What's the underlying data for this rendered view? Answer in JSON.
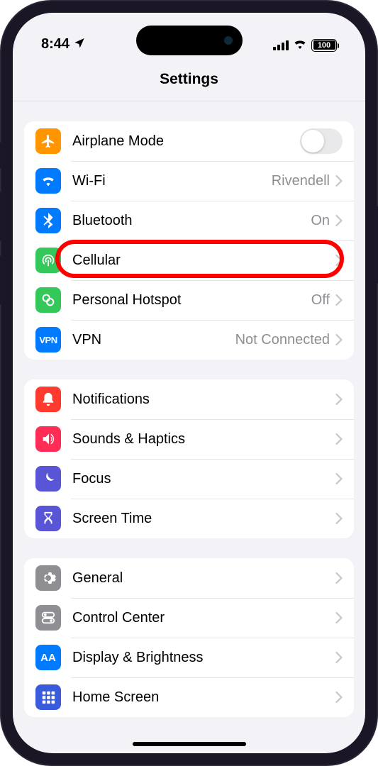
{
  "status": {
    "time": "8:44",
    "battery": "100"
  },
  "page_title": "Settings",
  "colors": {
    "orange": "#ff9500",
    "blue": "#007aff",
    "green": "#34c759",
    "red": "#ff3b30",
    "rose": "#ff2d55",
    "indigo": "#5856d6",
    "gray": "#8e8e93",
    "appblue": "#1f6dff"
  },
  "groups": [
    {
      "items": [
        {
          "name": "airplane",
          "label": "Airplane Mode",
          "icon": "airplane-icon",
          "color": "orange",
          "control": "toggle",
          "toggle_on": false
        },
        {
          "name": "wifi",
          "label": "Wi-Fi",
          "icon": "wifi-icon",
          "color": "blue",
          "value": "Rivendell",
          "chevron": true
        },
        {
          "name": "bluetooth",
          "label": "Bluetooth",
          "icon": "bluetooth-icon",
          "color": "blue",
          "value": "On",
          "chevron": true
        },
        {
          "name": "cellular",
          "label": "Cellular",
          "icon": "cellular-icon",
          "color": "green",
          "chevron": true,
          "highlighted": true
        },
        {
          "name": "hotspot",
          "label": "Personal Hotspot",
          "icon": "hotspot-icon",
          "color": "green",
          "value": "Off",
          "chevron": true
        },
        {
          "name": "vpn",
          "label": "VPN",
          "icon": "vpn-icon",
          "color": "blue",
          "value": "Not Connected",
          "chevron": true
        }
      ]
    },
    {
      "items": [
        {
          "name": "notifications",
          "label": "Notifications",
          "icon": "bell-icon",
          "color": "red",
          "chevron": true
        },
        {
          "name": "sounds",
          "label": "Sounds & Haptics",
          "icon": "speaker-icon",
          "color": "rose",
          "chevron": true
        },
        {
          "name": "focus",
          "label": "Focus",
          "icon": "moon-icon",
          "color": "indigo",
          "chevron": true
        },
        {
          "name": "screentime",
          "label": "Screen Time",
          "icon": "hourglass-icon",
          "color": "indigo",
          "chevron": true
        }
      ]
    },
    {
      "items": [
        {
          "name": "general",
          "label": "General",
          "icon": "gear-icon",
          "color": "gray",
          "chevron": true
        },
        {
          "name": "controlcenter",
          "label": "Control Center",
          "icon": "switches-icon",
          "color": "gray",
          "chevron": true
        },
        {
          "name": "display",
          "label": "Display & Brightness",
          "icon": "text-size-icon",
          "color": "blue",
          "chevron": true
        },
        {
          "name": "homescreen",
          "label": "Home Screen",
          "icon": "grid-icon",
          "color": "appblue",
          "chevron": true
        }
      ]
    }
  ]
}
